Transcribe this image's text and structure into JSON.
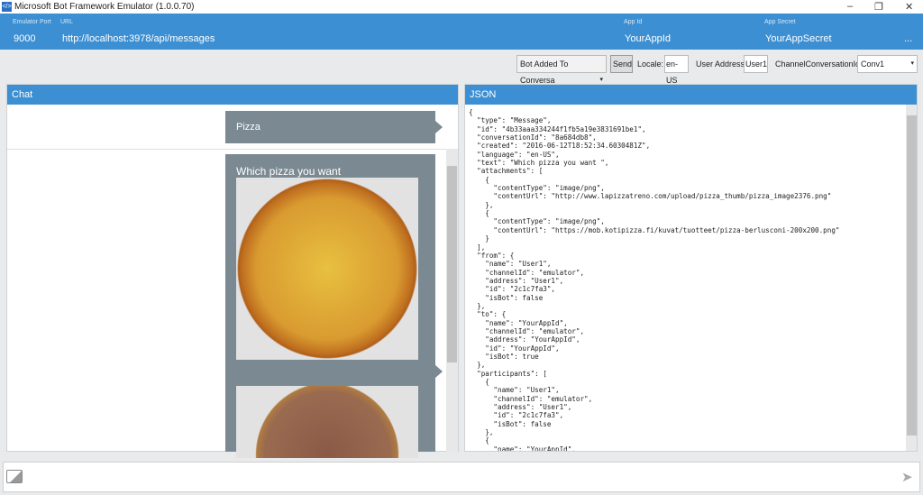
{
  "window": {
    "title": "Microsoft Bot Framework Emulator (1.0.0.70)",
    "minimize": "–",
    "restore": "❐",
    "close": "✕"
  },
  "header": {
    "port_label": "Emulator Port",
    "port": "9000",
    "url_label": "URL",
    "url": "http://localhost:3978/api/messages",
    "appid_label": "App Id",
    "appid": "YourAppId",
    "secret_label": "App Secret",
    "secret": "YourAppSecret",
    "more": "..."
  },
  "toolbar": {
    "activity_select": "Bot Added To Conversa",
    "send": "Send",
    "locale_label": "Locale:",
    "locale": "en-US",
    "user_label": "User Address:",
    "user": "User1",
    "conv_label": "ChannelConversationId:",
    "conv": "Conv1"
  },
  "chat": {
    "title": "Chat",
    "user_message": "Pizza",
    "bot_message": "Which pizza you want"
  },
  "json_panel": {
    "title": "JSON",
    "lines": [
      "{",
      "  \"type\": \"Message\",",
      "  \"id\": \"4b33aaa334244f1fb5a19e3831691be1\",",
      "  \"conversationId\": \"8a684db8\",",
      "  \"created\": \"2016-06-12T18:52:34.6030481Z\",",
      "  \"language\": \"en-US\",",
      "  \"text\": \"Which pizza you want \",",
      "  \"attachments\": [",
      "    {",
      "      \"contentType\": \"image/png\",",
      "      \"contentUrl\": \"http://www.lapizzatreno.com/upload/pizza_thumb/pizza_image2376.png\"",
      "    },",
      "    {",
      "      \"contentType\": \"image/png\",",
      "      \"contentUrl\": \"https://mob.kotipizza.fi/kuvat/tuotteet/pizza-berlusconi-200x200.png\"",
      "    }",
      "  ],",
      "  \"from\": {",
      "    \"name\": \"User1\",",
      "    \"channelId\": \"emulator\",",
      "    \"address\": \"User1\",",
      "    \"id\": \"2c1c7fa3\",",
      "    \"isBot\": false",
      "  },",
      "  \"to\": {",
      "    \"name\": \"YourAppId\",",
      "    \"channelId\": \"emulator\",",
      "    \"address\": \"YourAppId\",",
      "    \"id\": \"YourAppId\",",
      "    \"isBot\": true",
      "  },",
      "  \"participants\": [",
      "    {",
      "      \"name\": \"User1\",",
      "      \"channelId\": \"emulator\",",
      "      \"address\": \"User1\",",
      "      \"id\": \"2c1c7fa3\",",
      "      \"isBot\": false",
      "    },",
      "    {",
      "      \"name\": \"YourAppId\","
    ]
  },
  "input": {
    "placeholder": "",
    "send_icon": "➤"
  }
}
